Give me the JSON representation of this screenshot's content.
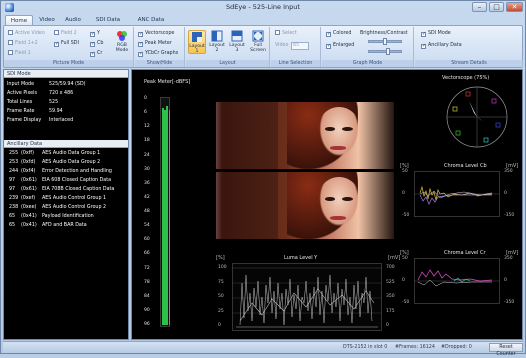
{
  "window": {
    "title": "SdEye - 525-Line Input"
  },
  "tabs": [
    "Home",
    "Video",
    "Audio",
    "SDI Data",
    "ANC Data"
  ],
  "ribbon": {
    "picture_mode": {
      "caption": "Picture Mode",
      "items": [
        "Active Video",
        "Field 2",
        "Y",
        "Field 1+2",
        "Full SDI",
        "Cb",
        "Field 1",
        "Cr"
      ],
      "rgb_mode": "RGB Mode"
    },
    "show_hide": {
      "caption": "Show/Hide",
      "items": [
        "Vectorscope",
        "Peak Meter",
        "YCbCr Graphs"
      ]
    },
    "layout": {
      "caption": "Layout",
      "buttons": [
        "Layout 1",
        "Layout 2",
        "Layout 3",
        "Full Screen"
      ]
    },
    "line_selection": {
      "caption": "Line Selection",
      "select": "Select",
      "video_label": "Video",
      "video_value": "85"
    },
    "graph_mode": {
      "caption": "Graph Mode",
      "items": [
        "Colored",
        "Enlarged"
      ],
      "brightness_label": "Brightness/Contrast",
      "brightness": 0.45,
      "contrast": 0.55
    },
    "stream_details": {
      "caption": "Stream Details",
      "items": [
        "SDI Mode",
        "Ancillary Data"
      ]
    }
  },
  "sdi_mode": {
    "header": "SDI Mode",
    "rows": [
      {
        "k": "Input Mode",
        "v": "525/59.94 (SD)"
      },
      {
        "k": "Active Pixels",
        "v": "720 x 486"
      },
      {
        "k": "Total Lines",
        "v": "525"
      },
      {
        "k": "Frame Rate",
        "v": "59.94"
      },
      {
        "k": "Frame Display",
        "v": "Interlaced"
      }
    ]
  },
  "ancillary": {
    "header": "Ancillary Data",
    "rows": [
      {
        "n": "255",
        "h": "(0xff)",
        "d": "AES Audio Data Group 1"
      },
      {
        "n": "253",
        "h": "(0xfd)",
        "d": "AES Audio Data Group 2"
      },
      {
        "n": "244",
        "h": "(0xf4)",
        "d": "Error Detection and Handling"
      },
      {
        "n": "97",
        "h": "(0x61)",
        "d": "EIA 608 Closed Caption Data"
      },
      {
        "n": "97",
        "h": "(0x61)",
        "d": "EIA 708B Closed Caption Data"
      },
      {
        "n": "239",
        "h": "(0xef)",
        "d": "AES Audio Control Group 1"
      },
      {
        "n": "238",
        "h": "(0xee)",
        "d": "AES Audio Control Group 2"
      },
      {
        "n": "65",
        "h": "(0x41)",
        "d": "Payload Identification"
      },
      {
        "n": "65",
        "h": "(0x41)",
        "d": "AFD and BAR Data"
      }
    ]
  },
  "peak_meter": {
    "title": "Peak Meter[-dBFS]",
    "scale": [
      "0",
      "6",
      "12",
      "18",
      "24",
      "30",
      "36",
      "42",
      "48",
      "54",
      "60",
      "66",
      "72",
      "78",
      "84",
      "90",
      "96"
    ],
    "levels": [
      0.96,
      0.95,
      0.97,
      0.95
    ],
    "color": "#2cc24a"
  },
  "vectorscope": {
    "title": "Vectorscope (75%)",
    "targets": [
      "R",
      "Mg",
      "B",
      "Cy",
      "G",
      "Yl"
    ]
  },
  "chroma_cb": {
    "title": "Chroma Level Cb",
    "unit_left": "[%]",
    "unit_right": "[mV]",
    "left_ticks": [
      "50",
      "0",
      "-50"
    ],
    "right_ticks": [
      "350",
      "0",
      "-350"
    ]
  },
  "chroma_cr": {
    "title": "Chroma Level Cr",
    "unit_left": "[%]",
    "unit_right": "[mV]",
    "left_ticks": [
      "50",
      "0",
      "-50"
    ],
    "right_ticks": [
      "350",
      "0",
      "-350"
    ]
  },
  "luma": {
    "title": "Luma Level Y",
    "unit_left": "[%]",
    "unit_right": "[mV]",
    "left_ticks": [
      "100",
      "75",
      "50",
      "25",
      "0"
    ],
    "right_ticks": [
      "700",
      "525",
      "350",
      "175",
      "0"
    ]
  },
  "status": {
    "dts": "DTS-2152 in slot 0",
    "frames": "#Frames: 16124",
    "dropped": "#Dropped: 0",
    "reset": "Reset Counter"
  }
}
